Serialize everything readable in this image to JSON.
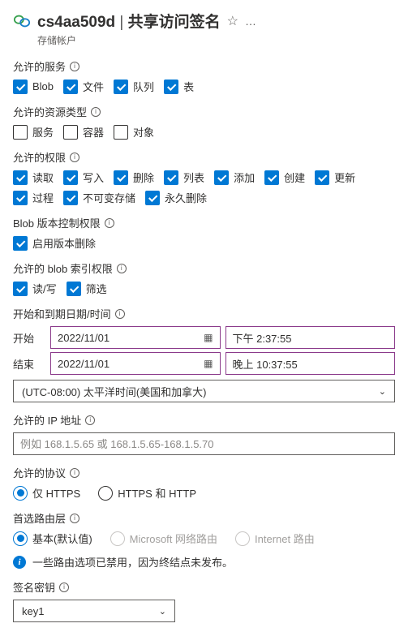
{
  "header": {
    "resource_name": "cs4aa509d",
    "page_title": "共享访问签名",
    "subtitle": "存储帐户"
  },
  "sections": {
    "services": {
      "label": "允许的服务",
      "items": [
        {
          "label": "Blob",
          "checked": true
        },
        {
          "label": "文件",
          "checked": true
        },
        {
          "label": "队列",
          "checked": true
        },
        {
          "label": "表",
          "checked": true
        }
      ]
    },
    "resource_types": {
      "label": "允许的资源类型",
      "items": [
        {
          "label": "服务",
          "checked": false
        },
        {
          "label": "容器",
          "checked": false
        },
        {
          "label": "对象",
          "checked": false
        }
      ]
    },
    "permissions": {
      "label": "允许的权限",
      "items": [
        {
          "label": "读取",
          "checked": true
        },
        {
          "label": "写入",
          "checked": true
        },
        {
          "label": "删除",
          "checked": true
        },
        {
          "label": "列表",
          "checked": true
        },
        {
          "label": "添加",
          "checked": true
        },
        {
          "label": "创建",
          "checked": true
        },
        {
          "label": "更新",
          "checked": true
        },
        {
          "label": "过程",
          "checked": true
        },
        {
          "label": "不可变存储",
          "checked": true
        },
        {
          "label": "永久删除",
          "checked": true
        }
      ]
    },
    "blob_version": {
      "label": "Blob 版本控制权限",
      "items": [
        {
          "label": "启用版本删除",
          "checked": true
        }
      ]
    },
    "blob_index": {
      "label": "允许的 blob 索引权限",
      "items": [
        {
          "label": "读/写",
          "checked": true
        },
        {
          "label": "筛选",
          "checked": true
        }
      ]
    },
    "datetime": {
      "label": "开始和到期日期/时间",
      "start_label": "开始",
      "start_date": "2022/11/01",
      "start_time": "下午 2:37:55",
      "end_label": "结束",
      "end_date": "2022/11/01",
      "end_time": "晚上 10:37:55",
      "timezone": "(UTC-08:00) 太平洋时间(美国和加拿大)"
    },
    "ip": {
      "label": "允许的 IP 地址",
      "placeholder": "例如 168.1.5.65 或 168.1.5.65-168.1.5.70"
    },
    "protocol": {
      "label": "允许的协议",
      "items": [
        {
          "label": "仅 HTTPS",
          "selected": true
        },
        {
          "label": "HTTPS 和 HTTP",
          "selected": false
        }
      ]
    },
    "routing": {
      "label": "首选路由层",
      "items": [
        {
          "label": "基本(默认值)",
          "selected": true,
          "disabled": false
        },
        {
          "label": "Microsoft 网络路由",
          "selected": false,
          "disabled": true
        },
        {
          "label": "Internet 路由",
          "selected": false,
          "disabled": true
        }
      ],
      "info_text": "一些路由选项已禁用，因为终结点未发布。"
    },
    "signing_key": {
      "label": "签名密钥",
      "value": "key1"
    }
  }
}
